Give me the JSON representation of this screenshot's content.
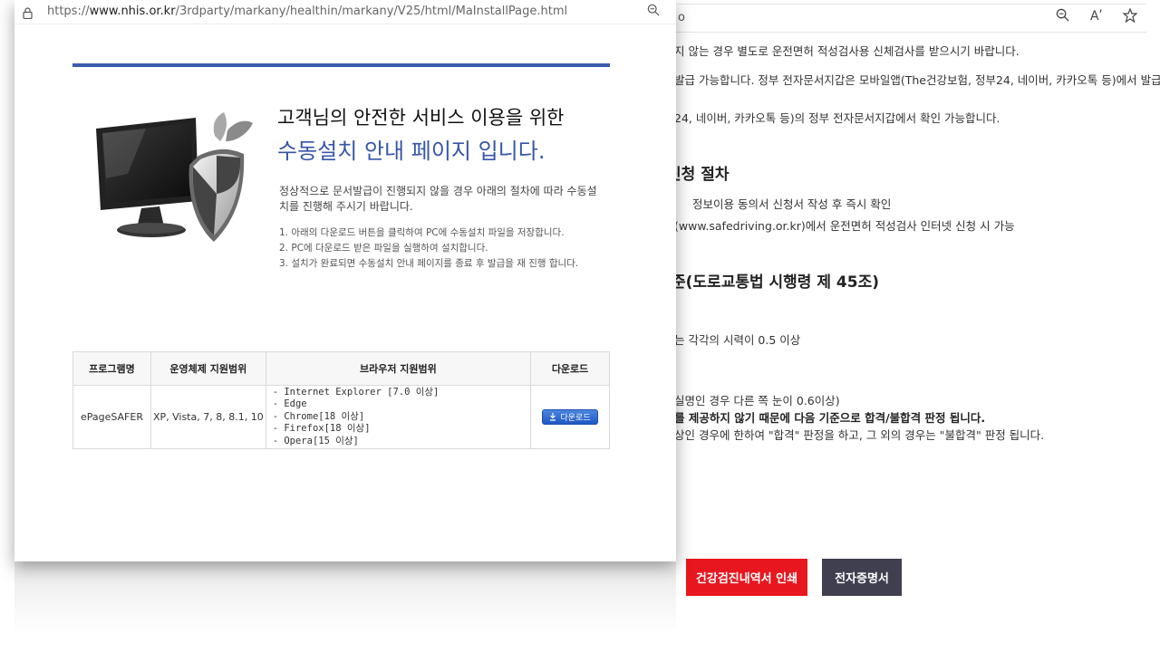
{
  "background_page": {
    "url_fragment": "o",
    "toolbar_icons": [
      "zoom-icon",
      "read-aloud-icon",
      "favorite-star-icon"
    ],
    "read_aloud_label": "Aʹ",
    "lines": [
      "지 않는 경우 별도로 운전면허 적성검사용 신체검사를 받으시기 바랍니다.",
      "발급 가능합니다. 정부 전자문서지갑은 모바일앱(The건강보험, 정부24, 네이버, 카카오톡 등)에서 발급 가",
      "24, 네이버, 카카오톡 등)의 정부 전자문서지갑에서 확인 가능합니다."
    ],
    "heading_procedure": "신청 절차",
    "procedure_lines": [
      "정보이용 동의서 신청서 작성 후 즉시 확인",
      "(www.safedriving.or.kr)에서 운전면허 적성검사 인터넷 신청 시 가능"
    ],
    "heading_standard": "준(도로교통법 시행령 제 45조)",
    "standard_lines": [
      "는 각각의 시력이 0.5 이상",
      "실명인 경우 다른 쪽 눈이 0.6이상)",
      "를 제공하지 않기 때문에 다음 기준으로 합격/불합격 판정 됩니다.",
      "상인 경우에 한하여 \"합격\" 판정을 하고, 그 외의 경우는 \"불합격\" 판정 됩니다."
    ],
    "buttons": {
      "print": "건강검진내역서 인쇄",
      "certificate": "전자증명서"
    }
  },
  "popup": {
    "url_prefix": "https://",
    "url_host": "www.nhis.or.kr",
    "url_path": "/3rdparty/markany/healthin/markany/V25/html/MaInstallPage.html",
    "title_line1": "고객님의 안전한 서비스 이용을 위한",
    "title_line2": "수동설치 안내 페이지 입니다.",
    "description": "정상적으로 문서발급이 진행되지 않을 경우 아래의 절차에 따라 수동설치를 진행해 주시기 바랍니다.",
    "steps": [
      "1. 아래의 다운로드 버튼을 클릭하여 PC에 수동설치 파일을 저장합니다.",
      "2. PC에 다운로드 받은 파일을 실행하여 설치합니다.",
      "3. 설치가 완료되면 수동설치 안내 페이지를 종료 후 발급을 재 진행 합니다."
    ],
    "table": {
      "headers": [
        "프로그램명",
        "운영체제 지원범위",
        "브라우저 지원범위",
        "다운로드"
      ],
      "row": {
        "program": "ePageSAFER",
        "os": "XP, Vista, 7, 8, 8.1, 10",
        "browsers": [
          "- Internet Explorer [7.0 이상]",
          "- Edge",
          "- Chrome[18 이상]",
          "- Firefox[18 이상]",
          "- Opera[15 이상]"
        ],
        "download_label": "다운로드"
      }
    },
    "colors": {
      "accent_blue": "#3a5dae",
      "title_blue": "#3656a8",
      "print_button_red": "#e8171f",
      "certificate_button_gray": "#3f3f4f"
    }
  }
}
